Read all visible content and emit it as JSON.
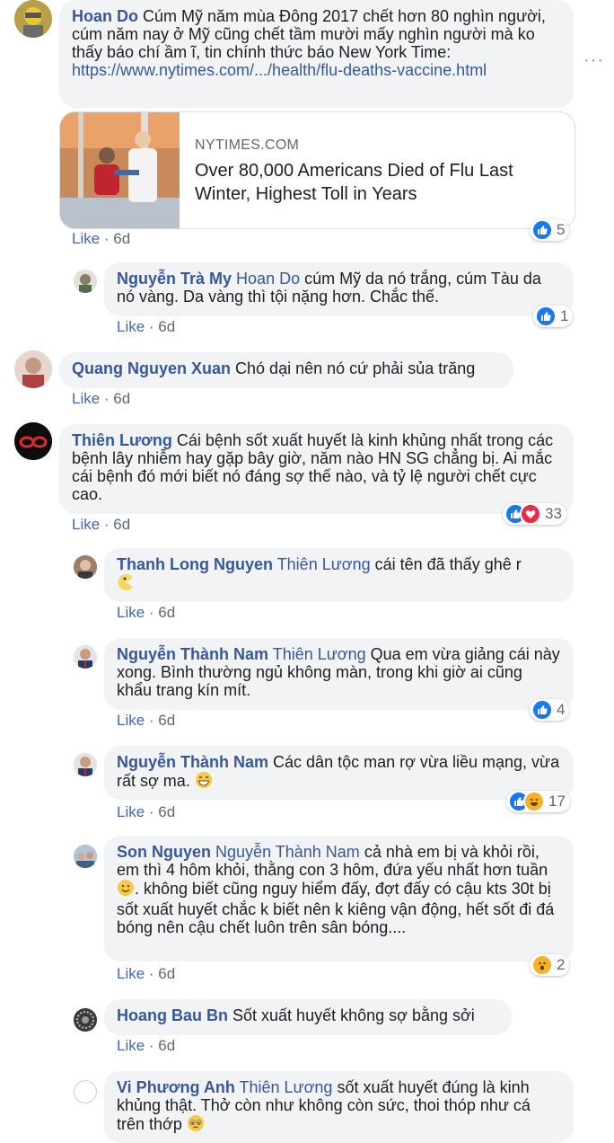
{
  "post_link": {
    "domain": "NYTIMES.COM",
    "title": "Over 80,000 Americans Died of Flu Last Winter, Highest Toll in Years"
  },
  "more_label": "···",
  "comments": [
    {
      "author": "Hoan Do",
      "text": "Cúm Mỹ năm mùa Đông 2017 chết hơn 80 nghìn người, cúm năm nay ở Mỹ cũng chết tầm mười mấy nghìn người mà ko thấy báo chí ầm ĩ, tin chính thức báo New York Time: ",
      "link": "https://www.nytimes.com/.../health/flu-deaths-vaccine.html",
      "like": "Like",
      "time": "6d",
      "reactions": "5"
    },
    {
      "author": "Nguyễn Trà My",
      "tag": "Hoan Do",
      "text": "cúm Mỹ da nó trắng, cúm Tàu da nó vàng. Da vàng thì tội nặng hơn. Chắc thế.",
      "like": "Like",
      "time": "6d",
      "reactions": "1"
    },
    {
      "author": "Quang Nguyen Xuan",
      "text": "Chó dại nên nó cứ phải sủa trăng",
      "like": "Like",
      "time": "6d"
    },
    {
      "author": "Thiên Lương",
      "text": "Cái bệnh sốt xuất huyết là kinh khủng nhất trong các bệnh lây nhiễm hay gặp bây giờ, năm nào HN SG chẳng bị. Ai mắc cái bệnh đó mới biết nó đáng sợ thế nào, và tỷ lệ người chết cực cao.",
      "like": "Like",
      "time": "6d",
      "reactions": "33"
    },
    {
      "author": "Thanh Long Nguyen",
      "tag": "Thiên Lương",
      "text": "cái tên đã thấy ghê r",
      "like": "Like",
      "time": "6d"
    },
    {
      "author": "Nguyễn Thành Nam",
      "tag": "Thiên Lương",
      "text": "Qua em vừa giảng cái này xong. Bình thường ngủ không màn, trong khi giờ ai cũng khẩu trang kín mít.",
      "like": "Like",
      "time": "6d",
      "reactions": "4"
    },
    {
      "author": "Nguyễn Thành Nam",
      "text": "Các dân tộc man rợ vừa liều mạng, vừa rất sợ ma.",
      "like": "Like",
      "time": "6d",
      "reactions": "17"
    },
    {
      "author": "Son Nguyen",
      "tag": "Nguyễn Thành Nam",
      "text1": "cả nhà em bị và khỏi rồi, em thì 4 hôm khỏi, thằng con 3 hôm, đứa yếu nhất hơn tuần",
      "text2": ". không biết cũng nguy hiểm đấy, đợt đấy có cậu kts 30t bị sốt xuất huyết chắc k biết nên k kiêng vận động, hết sốt đi đá bóng nên cậu chết luôn trên sân bóng....",
      "like": "Like",
      "time": "6d",
      "reactions": "2"
    },
    {
      "author": "Hoang Bau Bn",
      "text": "Sốt xuất huyết không sợ bằng sởi",
      "like": "Like",
      "time": "6d"
    },
    {
      "author": "Vi Phương Anh",
      "tag": "Thiên Lương",
      "text": "sốt xuất huyết đúng là kinh khủng thật. Thở còn như không còn sức, thoi thóp như cá trên thớp"
    }
  ]
}
